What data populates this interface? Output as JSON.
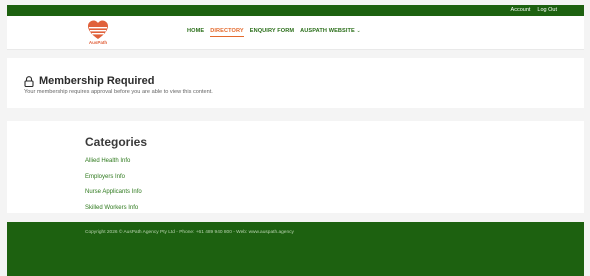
{
  "topbar": {
    "account_label": "Account",
    "logout_label": "Log Out"
  },
  "logo": {
    "text": "AusPath"
  },
  "nav": {
    "items": [
      {
        "label": "HOME"
      },
      {
        "label": "DIRECTORY"
      },
      {
        "label": "ENQUIRY FORM"
      },
      {
        "label": "AUSPATH WEBSITE"
      }
    ]
  },
  "notice": {
    "title": "Membership Required",
    "message": "Your membership requires approval before you are able to view this content."
  },
  "categories": {
    "heading": "Categories",
    "items": [
      "Allied Health Info",
      "Employers Info",
      "Nurse Applicants Info",
      "Skilled Workers Info"
    ]
  },
  "footer": {
    "copyright": "Copyright 2026 © AusPath Agency Pty Ltd - Phone: +61 489 940 800 - Web: www.auspath.agency"
  },
  "colors": {
    "brand_green": "#1d6110",
    "accent_orange": "#e46a2d",
    "link_green": "#2f7a1e"
  },
  "icons": {
    "lock": "lock-icon",
    "dropdown": "chevron-down-icon"
  }
}
